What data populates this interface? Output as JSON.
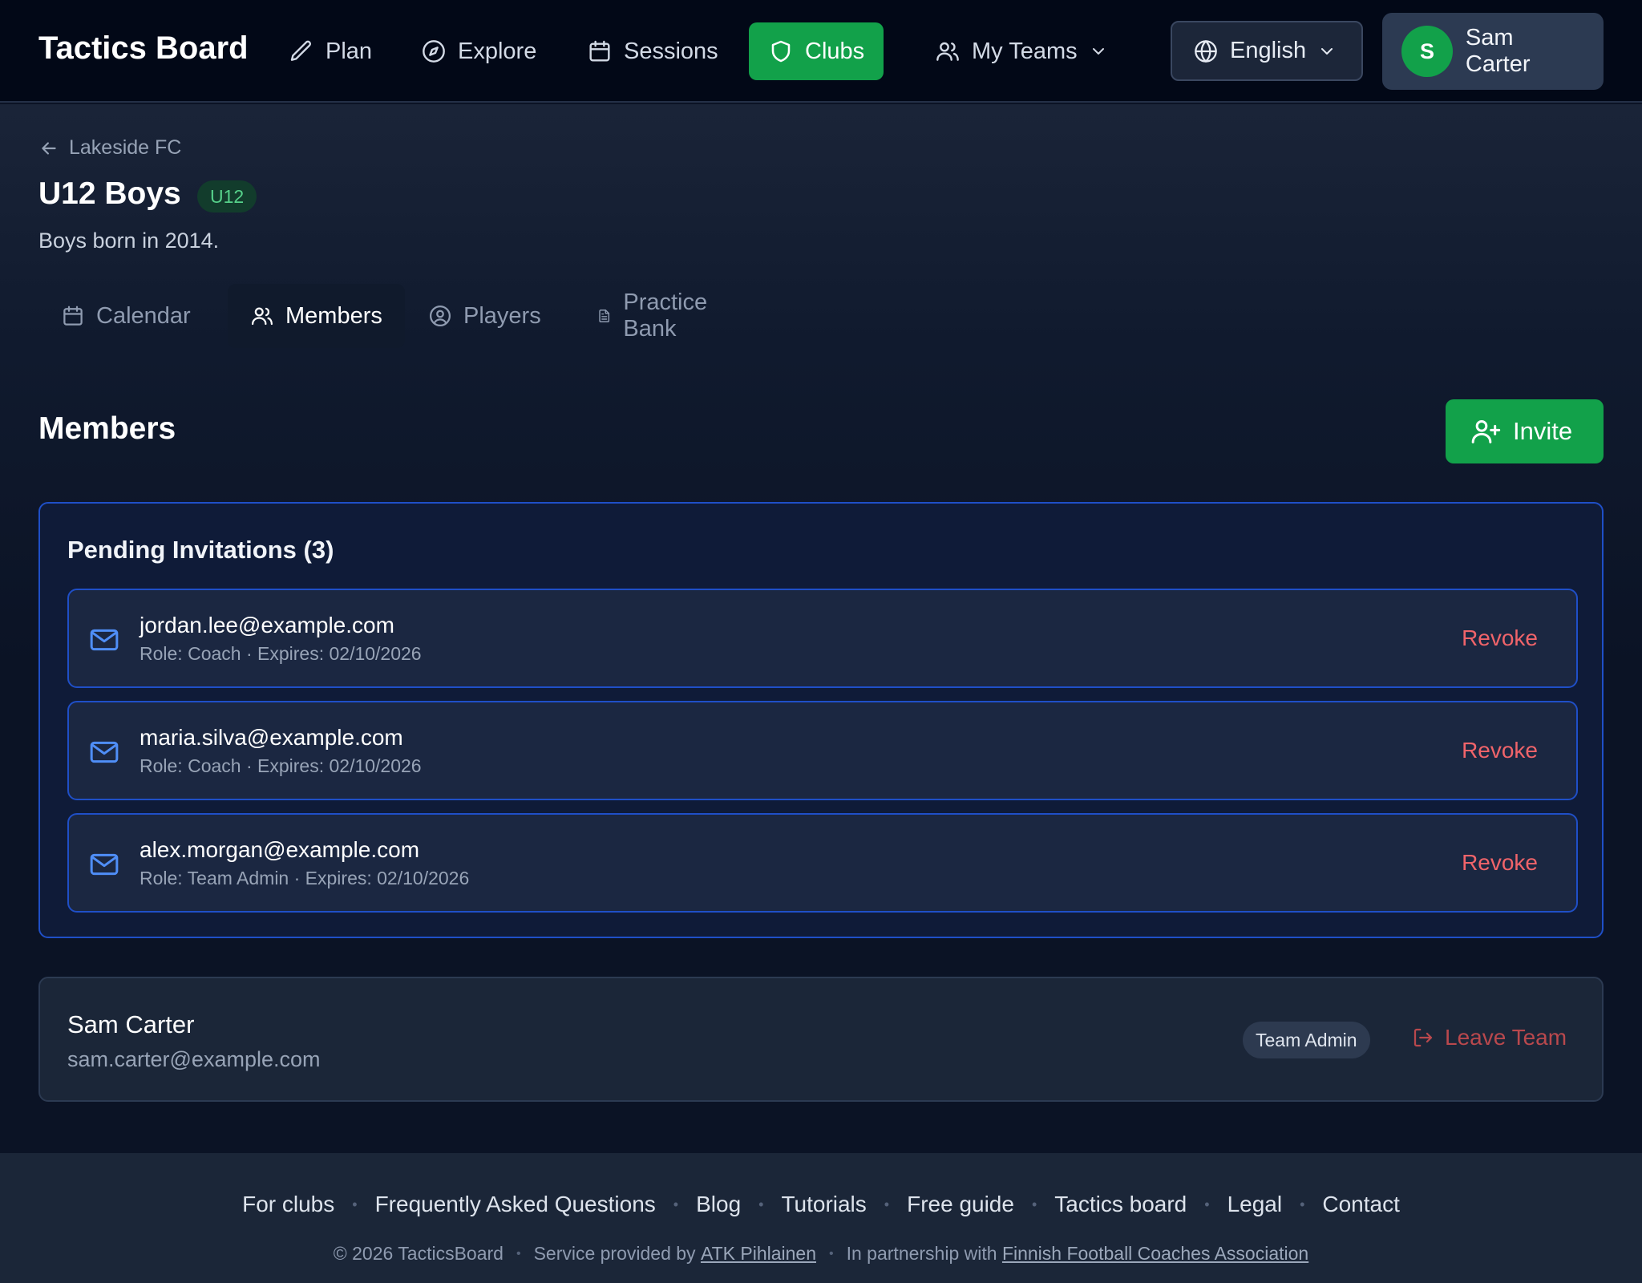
{
  "header": {
    "brand": "Tactics Board",
    "nav": [
      {
        "label": "Plan",
        "icon": "pencil-icon"
      },
      {
        "label": "Explore",
        "icon": "compass-icon"
      },
      {
        "label": "Sessions",
        "icon": "calendar-icon"
      },
      {
        "label": "Clubs",
        "icon": "shield-icon",
        "active": true
      },
      {
        "label": "My Teams",
        "icon": "users-icon"
      }
    ],
    "language": "English",
    "user": {
      "initial": "S",
      "name": "Sam Carter"
    }
  },
  "page": {
    "breadcrumb": "Lakeside FC",
    "title": "U12 Boys",
    "badge": "U12",
    "description": "Boys born in 2014.",
    "tabs": [
      {
        "label": "Calendar",
        "icon": "calendar-icon"
      },
      {
        "label": "Members",
        "icon": "users-icon",
        "active": true
      },
      {
        "label": "Players",
        "icon": "user-circle-icon"
      },
      {
        "label": "Practice Bank",
        "icon": "document-icon"
      }
    ]
  },
  "members": {
    "section_title": "Members",
    "invite_label": "Invite",
    "pending_title": "Pending Invitations (3)",
    "invitations": [
      {
        "email": "jordan.lee@example.com",
        "meta": "Role: Coach · Expires: 02/10/2026",
        "action": "Revoke"
      },
      {
        "email": "maria.silva@example.com",
        "meta": "Role: Coach · Expires: 02/10/2026",
        "action": "Revoke"
      },
      {
        "email": "alex.morgan@example.com",
        "meta": "Role: Team Admin · Expires: 02/10/2026",
        "action": "Revoke"
      }
    ],
    "current": {
      "name": "Sam Carter",
      "email": "sam.carter@example.com",
      "role": "Team Admin",
      "leave_label": "Leave Team"
    }
  },
  "footer": {
    "links": [
      "For clubs",
      "Frequently Asked Questions",
      "Blog",
      "Tutorials",
      "Free guide",
      "Tactics board",
      "Legal",
      "Contact"
    ],
    "copyright": "© 2026 TacticsBoard",
    "service_prefix": "Service provided by",
    "service_link": "ATK Pihlainen",
    "partner_prefix": "In partnership with",
    "partner_link": "Finnish Football Coaches Association"
  },
  "colors": {
    "accent_green": "#12a14a",
    "invite_border_blue": "#1f4fc7",
    "revoke_red": "#f0646a",
    "background": "#0b1325"
  }
}
